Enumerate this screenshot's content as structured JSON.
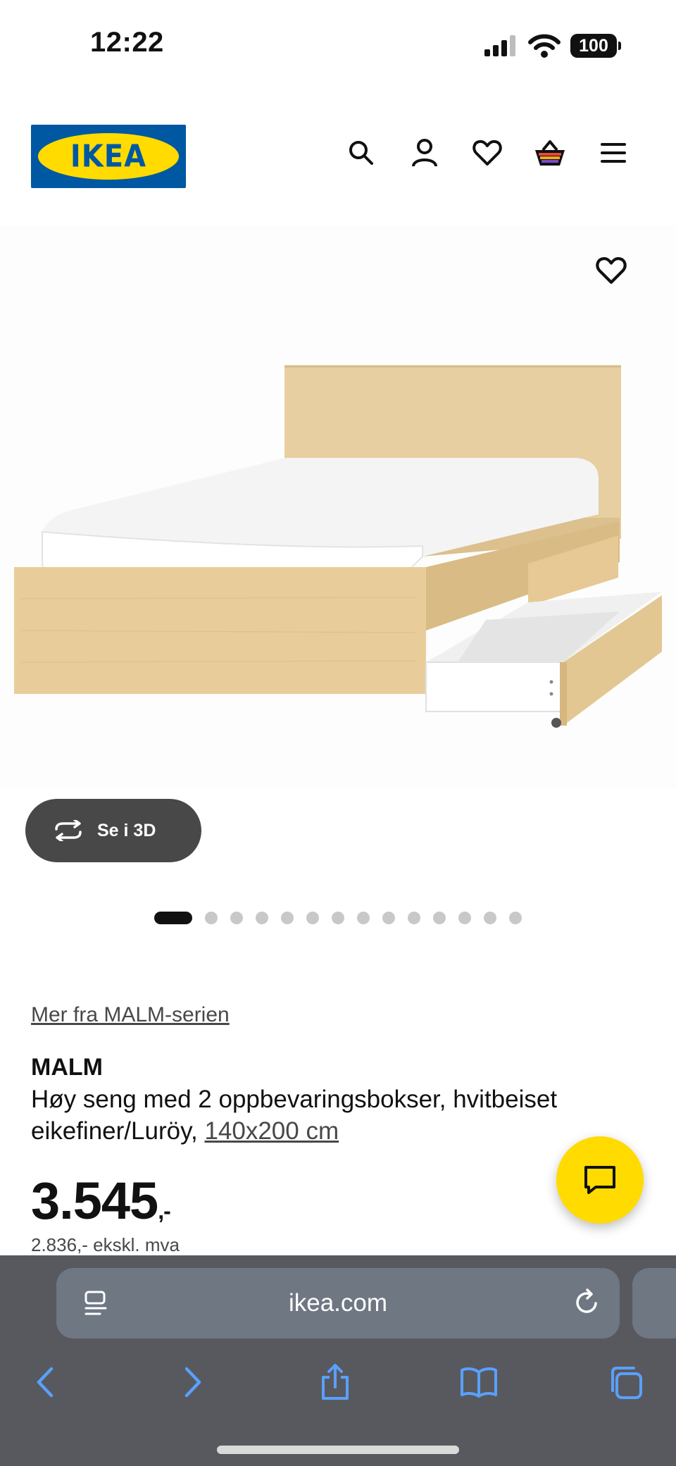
{
  "status": {
    "time": "12:22",
    "battery": "100"
  },
  "header": {
    "logo_text": "IKEA",
    "logo_reg": "®"
  },
  "icons": {
    "search": "search-icon",
    "account": "user-icon",
    "favourites": "heart-icon",
    "basket": "basket-icon",
    "menu": "hamburger-menu-icon",
    "chat": "chat-icon"
  },
  "product": {
    "view_3d_label": "Se i 3D",
    "image_count": 14,
    "active_image": 1,
    "series_link": "Mer fra MALM-serien",
    "name": "MALM",
    "description": "Høy seng med 2 oppbevaringsbokser, hvitbeiset eikefiner/Luröy,",
    "size_link": "140x200 cm",
    "price": "3.545",
    "price_suffix": ",-",
    "price_ex_vat": "2.836,- ekskl. mva"
  },
  "browser": {
    "url": "ikea.com"
  },
  "colors": {
    "ikea_blue": "#0058a3",
    "ikea_yellow": "#ffdb00",
    "browser_accent": "#5aa0ff"
  }
}
